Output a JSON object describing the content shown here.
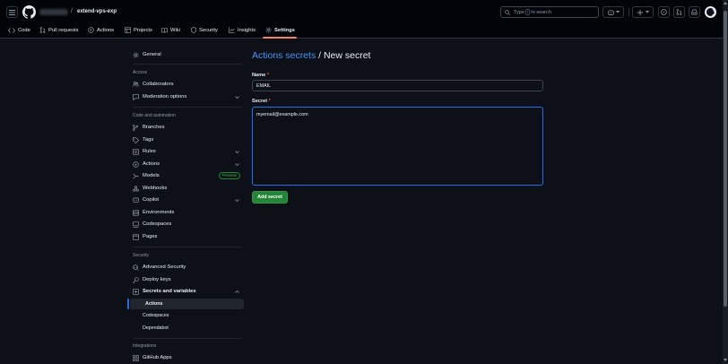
{
  "header": {
    "repo_name": "extend-vps-exp",
    "separator": "/",
    "search": {
      "prefix": "Type",
      "key": "/",
      "suffix": "to search"
    }
  },
  "nav": {
    "tabs": [
      {
        "label": "Code",
        "icon": "code-icon"
      },
      {
        "label": "Pull requests",
        "icon": "pull-request-icon"
      },
      {
        "label": "Actions",
        "icon": "play-icon"
      },
      {
        "label": "Projects",
        "icon": "table-icon"
      },
      {
        "label": "Wiki",
        "icon": "book-icon"
      },
      {
        "label": "Security",
        "icon": "shield-icon"
      },
      {
        "label": "Insights",
        "icon": "graph-icon"
      },
      {
        "label": "Settings",
        "icon": "gear-icon"
      }
    ],
    "active": "Settings"
  },
  "sidebar": {
    "general": "General",
    "sections": {
      "access": "Access",
      "code_automation": "Code and automation",
      "security": "Security",
      "integrations": "Integrations"
    },
    "items": {
      "collaborators": "Collaborators",
      "moderation": "Moderation options",
      "branches": "Branches",
      "tags": "Tags",
      "rules": "Rules",
      "actions": "Actions",
      "models": "Models",
      "models_badge": "Preview",
      "webhooks": "Webhooks",
      "copilot": "Copilot",
      "environments": "Environments",
      "codespaces": "Codespaces",
      "pages": "Pages",
      "advanced_security": "Advanced Security",
      "deploy_keys": "Deploy keys",
      "secrets_variables": "Secrets and variables",
      "sub_actions": "Actions",
      "sub_codespaces": "Codespaces",
      "sub_dependabot": "Dependabot",
      "github_apps": "GitHub Apps"
    }
  },
  "main": {
    "breadcrumb_link": "Actions secrets",
    "title_rest": " / New secret",
    "name_label": "Name",
    "name_value": "EMAIL",
    "secret_label": "Secret",
    "secret_value": "myemail@example.com",
    "required_mark": "*",
    "submit_label": "Add secret"
  },
  "colors": {
    "background": "#0d1117",
    "header_bg": "#010409",
    "link": "#4493f8",
    "focus_border": "#1f6feb",
    "primary_button": "#238636",
    "nav_underline": "#f78166"
  }
}
